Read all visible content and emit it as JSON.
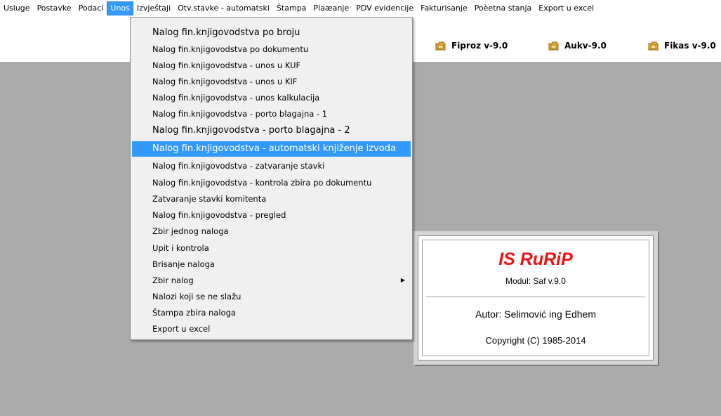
{
  "menubar": {
    "items": [
      {
        "label": "Usluge"
      },
      {
        "label": "Postavke"
      },
      {
        "label": "Podaci"
      },
      {
        "label": "Unos",
        "active": true
      },
      {
        "label": "Izvještaji"
      },
      {
        "label": "Otv.stavke - automatski"
      },
      {
        "label": "Štampa"
      },
      {
        "label": "Plaæanje"
      },
      {
        "label": "PDV evidencije"
      },
      {
        "label": "Fakturisanje"
      },
      {
        "label": "Poèetna stanja"
      },
      {
        "label": "Export u excel"
      }
    ]
  },
  "toolbar": {
    "buttons": [
      {
        "label": "Fiproz v-9.0",
        "icon": "folder-icon"
      },
      {
        "label": "Aukv-9.0",
        "icon": "folder-icon"
      },
      {
        "label": "Fikas v-9.0",
        "icon": "folder-icon"
      }
    ]
  },
  "dropdown": {
    "items": [
      {
        "label": "Nalog fin.knjigovodstva po broju"
      },
      {
        "label": "Nalog fin.knjigovodstva  po dokumentu"
      },
      {
        "label": "Nalog fin.knjigovodstva - unos u KUF"
      },
      {
        "label": "Nalog fin.knjigovodstva - unos u KIF"
      },
      {
        "label": "Nalog fin.knjigovodstva - unos kalkulacija"
      },
      {
        "label": "Nalog fin.knjigovodstva - porto blagajna - 1"
      },
      {
        "label": "Nalog fin.knjigovodstva - porto blagajna - 2"
      },
      {
        "label": "Nalog fin.knjigovodstva - automatski knjiženje izvoda"
      },
      {
        "label": "Nalog fin.knjigovodstva - zatvaranje stavki"
      },
      {
        "label": "Nalog  fin.knjigovodstva - kontrola zbira po dokumentu"
      },
      {
        "label": "Zatvaranje stavki komitenta"
      },
      {
        "label": "Nalog fin.knjigovodstva - pregled"
      },
      {
        "label": "Zbir jednog naloga"
      },
      {
        "label": "Upit i kontrola"
      },
      {
        "label": "Brisanje naloga"
      },
      {
        "label": "Zbir nalog",
        "submenu": true
      },
      {
        "label": "Nalozi koji se ne slažu"
      },
      {
        "label": "Štampa zbira naloga"
      },
      {
        "label": "Export u excel"
      }
    ],
    "highlighted_index": 7
  },
  "about": {
    "title": "IS RuRiP",
    "modul": "Modul: Saf v.9.0",
    "autor": "Autor: Selimović ing Edhem",
    "copyright": "Copyright (C) 1985-2014"
  },
  "colors": {
    "highlight": "#3399ff",
    "desktop": "#ababab",
    "title_red": "#ee1111",
    "folder": "#e8b030"
  }
}
